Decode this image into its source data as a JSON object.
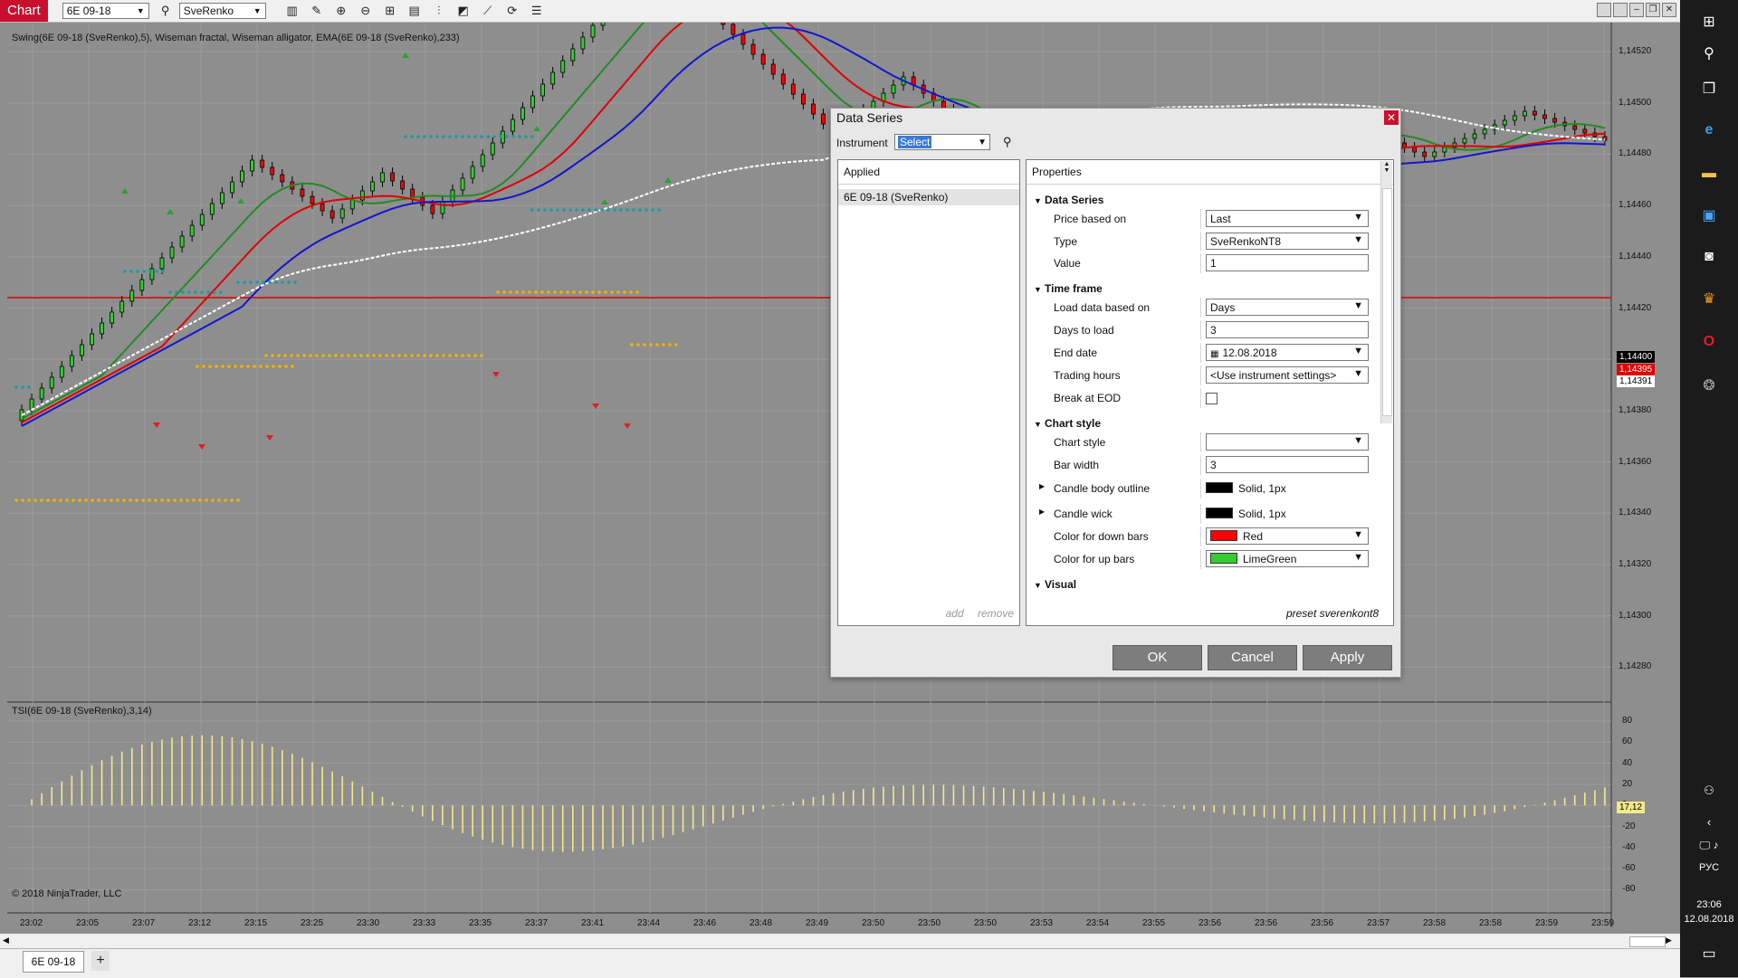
{
  "toolbar": {
    "chart_tab": "Chart",
    "instrument": "6E 09-18",
    "bar_type": "SveRenko",
    "icons": [
      "search-icon",
      "bars-icon",
      "pencil-icon",
      "zoom-in-icon",
      "zoom-out-icon",
      "grid-icon",
      "properties-icon",
      "indicators-icon",
      "strategies-icon",
      "drawing-icon",
      "refresh-icon",
      "list-icon"
    ]
  },
  "chart": {
    "indicator_label": "Swing(6E 09-18 (SveRenko),5), Wiseman fractal, Wiseman alligator, EMA(6E 09-18 (SveRenko),233)",
    "tsi_label": "TSI(6E 09-18 (SveRenko),3,14)",
    "copyright": "© 2018 NinjaTrader, LLC",
    "price_ticks": [
      "1,14520",
      "1,14500",
      "1,14480",
      "1,14460",
      "1,14440",
      "1,14420",
      "1,14400",
      "1,14380",
      "1,14360",
      "1,14340",
      "1,14320",
      "1,14300",
      "1,14280"
    ],
    "price_tag_current": "1,14400",
    "price_tag_red": "1,14395",
    "price_tag_white": "1,14391",
    "tsi_ticks": [
      "80",
      "60",
      "40",
      "20",
      "0",
      "-20",
      "-40",
      "-60",
      "-80"
    ],
    "tsi_tag": "17,12",
    "time_labels": [
      "23:02",
      "23:05",
      "23:07",
      "23:12",
      "23:15",
      "23:25",
      "23:30",
      "23:33",
      "23:35",
      "23:37",
      "23:41",
      "23:44",
      "23:46",
      "23:48",
      "23:49",
      "23:50",
      "23:50",
      "23:50",
      "23:53",
      "23:54",
      "23:55",
      "23:56",
      "23:56",
      "23:56",
      "23:57",
      "23:58",
      "23:58",
      "23:59",
      "23:59"
    ],
    "colors": {
      "up": "#32cd32",
      "down": "#ff0000",
      "ema": "#ffffff",
      "tsi": "#f3e98a",
      "swing_high": "#1e9aa0",
      "swing_low": "#f0b400"
    }
  },
  "bottom": {
    "tab": "6E 09-18",
    "add": "+"
  },
  "taskbar": {
    "lang": "РУС",
    "time": "23:06",
    "date": "12.08.2018"
  },
  "dialog": {
    "title": "Data Series",
    "close": "✕",
    "instrument_label": "Instrument",
    "instrument_value": "Select",
    "applied_header": "Applied",
    "applied_items": [
      "6E 09-18 (SveRenko)"
    ],
    "add": "add",
    "remove": "remove",
    "properties_header": "Properties",
    "sections": {
      "data_series": "Data Series",
      "time_frame": "Time frame",
      "chart_style": "Chart style",
      "visual": "Visual"
    },
    "props": {
      "price_based_on": {
        "label": "Price based on",
        "value": "Last"
      },
      "type": {
        "label": "Type",
        "value": "SveRenkoNT8"
      },
      "value": {
        "label": "Value",
        "value": "1"
      },
      "load_data_based_on": {
        "label": "Load data based on",
        "value": "Days"
      },
      "days_to_load": {
        "label": "Days to load",
        "value": "3"
      },
      "end_date": {
        "label": "End date",
        "value": "12.08.2018"
      },
      "trading_hours": {
        "label": "Trading hours",
        "value": "<Use instrument settings>"
      },
      "break_at_eod": {
        "label": "Break at EOD",
        "value": ""
      },
      "chart_style": {
        "label": "Chart style",
        "value": ""
      },
      "bar_width": {
        "label": "Bar width",
        "value": "3"
      },
      "candle_body_outline": {
        "label": "Candle body outline",
        "value": "Solid, 1px"
      },
      "candle_wick": {
        "label": "Candle wick",
        "value": "Solid, 1px"
      },
      "color_down": {
        "label": "Color for down bars",
        "value": "Red",
        "color": "#ff0000"
      },
      "color_up": {
        "label": "Color for up bars",
        "value": "LimeGreen",
        "color": "#32cd32"
      }
    },
    "preset": "preset sverenkont8",
    "buttons": {
      "ok": "OK",
      "cancel": "Cancel",
      "apply": "Apply"
    }
  }
}
